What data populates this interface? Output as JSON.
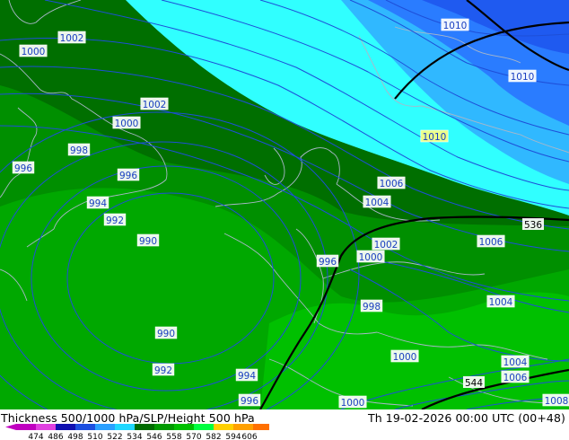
{
  "product": {
    "title": "Thickness 500/1000 hPa/SLP/Height 500 hPa",
    "valid_time": "Th 19-02-2026 00:00 UTC (00+48)"
  },
  "legend": {
    "ticks": [
      "474",
      "486",
      "498",
      "510",
      "522",
      "534",
      "546",
      "558",
      "570",
      "582",
      "594",
      "606"
    ],
    "colors": [
      "#c000c0",
      "#e040e0",
      "#1010b0",
      "#1c4fe0",
      "#2aa0ff",
      "#20d8ff",
      "#006b00",
      "#009a00",
      "#00c000",
      "#00ff40",
      "#ffd000",
      "#ffa000",
      "#ff7000"
    ]
  },
  "map_colors": {
    "deep_green": "#006f00",
    "mid_green": "#008f00",
    "light_green": "#00a800",
    "bright_green": "#00c000",
    "cyan": "#30ffff",
    "sky": "#30b8ff",
    "blue": "#2a7cff",
    "dark_blue": "#1f5af0",
    "isobar": "#1e4fd8",
    "coastline": "#a9b7c9",
    "thickness_line": "#000000"
  },
  "isobar_labels": [
    "1000",
    "1002",
    "1002",
    "1000",
    "998",
    "996",
    "996",
    "994",
    "992",
    "990",
    "990",
    "992",
    "994",
    "996",
    "996",
    "1000",
    "1002",
    "1004",
    "1006",
    "1010",
    "1010",
    "1010",
    "1006",
    "1004",
    "998",
    "1000",
    "1004",
    "1006",
    "1008",
    "1000"
  ],
  "thickness_labels": [
    "536",
    "544"
  ]
}
